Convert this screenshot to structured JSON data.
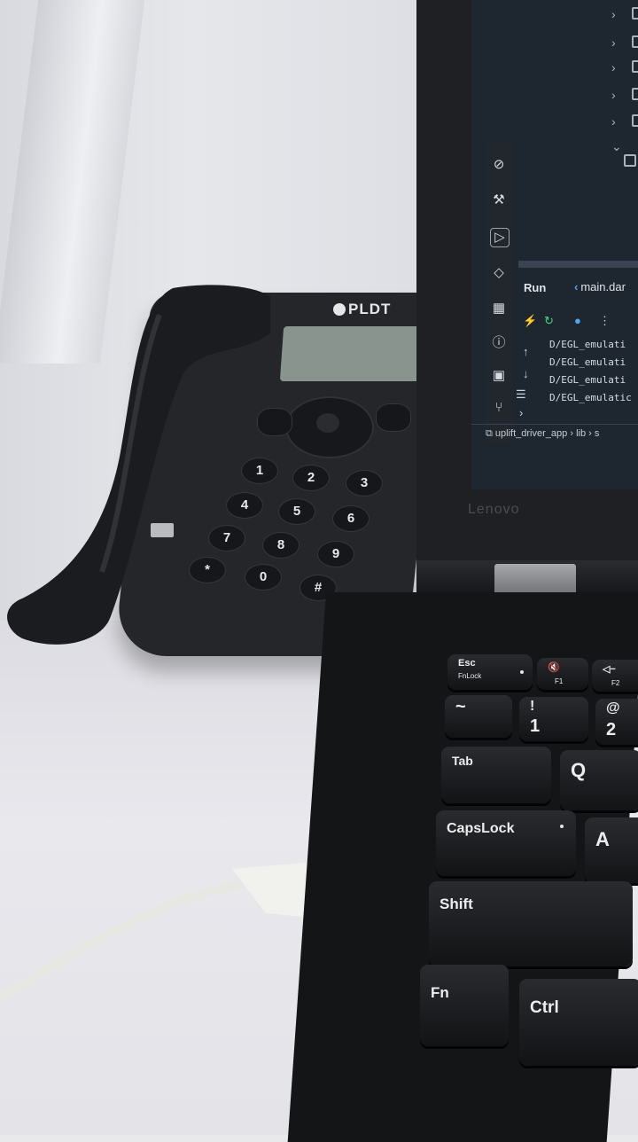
{
  "phone": {
    "brand": "PLDT",
    "keys": [
      "1",
      "2",
      "3",
      "4",
      "5",
      "6",
      "7",
      "8",
      "9",
      "*",
      "0",
      "#"
    ]
  },
  "laptop": {
    "lid_logo": "Lenovo",
    "ide": {
      "run_tab": "Run",
      "file_tab": "main.dar",
      "log_lines": [
        "D/EGL_emulati",
        "D/EGL_emulati",
        "D/EGL_emulati",
        "D/EGL_emulatic"
      ],
      "breadcrumb": [
        "uplift_driver_app",
        "lib",
        "s"
      ]
    },
    "keyboard": {
      "esc": "Esc",
      "fnlock": "FnLock",
      "f1": "F1",
      "f2": "F2",
      "key_1_top": "!",
      "key_1": "1",
      "key_2_top": "@",
      "key_2": "2",
      "key_tilde": "~",
      "tab": "Tab",
      "q": "Q",
      "capslock": "CapsLock",
      "a": "A",
      "shift": "Shift",
      "fn": "Fn",
      "ctrl": "Ctrl"
    }
  },
  "colors": {
    "wall": "#e0e1e6",
    "phone": "#24262a",
    "screen": "#1e2630",
    "accent_dart": "#4aa8f0"
  }
}
